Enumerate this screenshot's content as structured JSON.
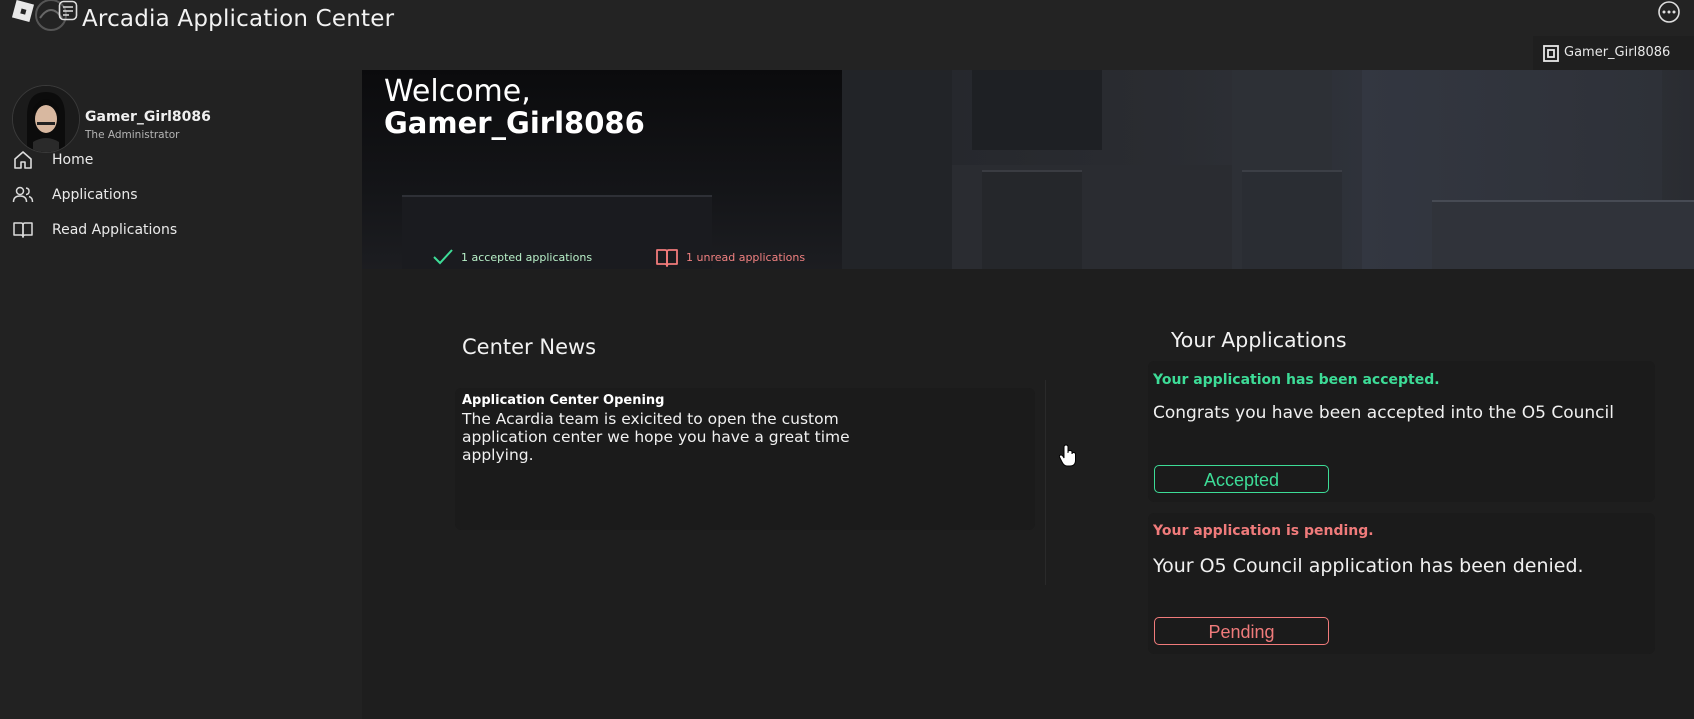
{
  "app": {
    "title": "Arcadia Application Center"
  },
  "topbar": {
    "user_name": "Gamer_Girl8086"
  },
  "profile": {
    "name": "Gamer_Girl8086",
    "role": "The Administrator"
  },
  "sidebar": {
    "items": [
      {
        "label": "Home",
        "icon": "home-icon"
      },
      {
        "label": "Applications",
        "icon": "users-icon"
      },
      {
        "label": "Read Applications",
        "icon": "book-open-icon"
      }
    ]
  },
  "banner": {
    "welcome": "Welcome,",
    "name": "Gamer_Girl8086",
    "stats": {
      "accepted": "1 accepted applications",
      "unread": "1 unread applications"
    }
  },
  "news": {
    "section_title": "Center News",
    "items": [
      {
        "title": "Application Center Opening",
        "body": "The Acardia team is exicited to open the custom application center we hope you have a great time applying."
      }
    ]
  },
  "applications": {
    "section_title": "Your Applications",
    "items": [
      {
        "status_text": "Your application has been accepted.",
        "message": "Congrats you have been accepted into the O5 Council",
        "badge": "Accepted",
        "color": "#3ddc97"
      },
      {
        "status_text": "Your application is pending.",
        "message": "Your O5 Council application has been denied.",
        "badge": "Pending",
        "color": "#f07b7b"
      }
    ]
  },
  "colors": {
    "accent_green": "#3ddc97",
    "accent_red": "#f07b7b",
    "background": "#1e1e1e",
    "sidebar": "#222222"
  }
}
